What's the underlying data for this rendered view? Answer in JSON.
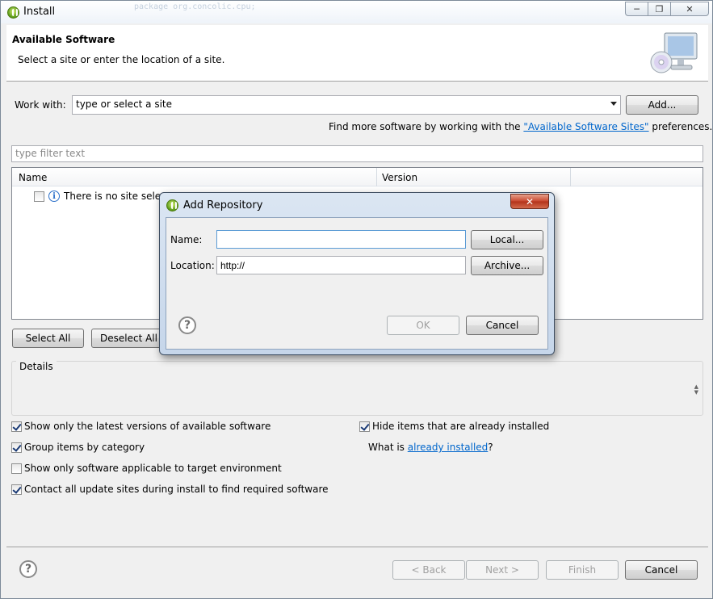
{
  "window": {
    "title": "Install",
    "background_code_hint": "package org.concolic.cpu;"
  },
  "header": {
    "title": "Available Software",
    "subtitle": "Select a site or enter the location of a site."
  },
  "work_with": {
    "label": "Work with:",
    "value": "type or select a site",
    "add_label": "Add..."
  },
  "find_more": {
    "prefix": "Find more software by working with the ",
    "link": "\"Available Software Sites\"",
    "suffix": " preferences."
  },
  "filter": {
    "placeholder": "type filter text"
  },
  "tree": {
    "columns": [
      "Name",
      "Version"
    ],
    "message": "There is no site selected."
  },
  "selection_buttons": {
    "select_all": "Select All",
    "deselect_all": "Deselect All"
  },
  "details": {
    "legend": "Details"
  },
  "options": [
    {
      "label": "Show only the latest versions of available software",
      "checked": true
    },
    {
      "label": "Group items by category",
      "checked": true
    },
    {
      "label": "Show only software applicable to target environment",
      "checked": false
    },
    {
      "label": "Contact all update sites during install to find required software",
      "checked": true
    }
  ],
  "right_options": {
    "hide_installed": {
      "label": "Hide items that are already installed",
      "checked": true
    },
    "what_is_prefix": "What is ",
    "what_is_link": "already installed",
    "what_is_suffix": "?"
  },
  "wizard_buttons": {
    "back": "< Back",
    "next": "Next >",
    "finish": "Finish",
    "cancel": "Cancel"
  },
  "dialog": {
    "title": "Add Repository",
    "close_glyph": "✕",
    "name_label": "Name:",
    "name_value": "",
    "location_label": "Location:",
    "location_value": "http://",
    "local_label": "Local...",
    "archive_label": "Archive...",
    "ok_label": "OK",
    "cancel_label": "Cancel"
  }
}
